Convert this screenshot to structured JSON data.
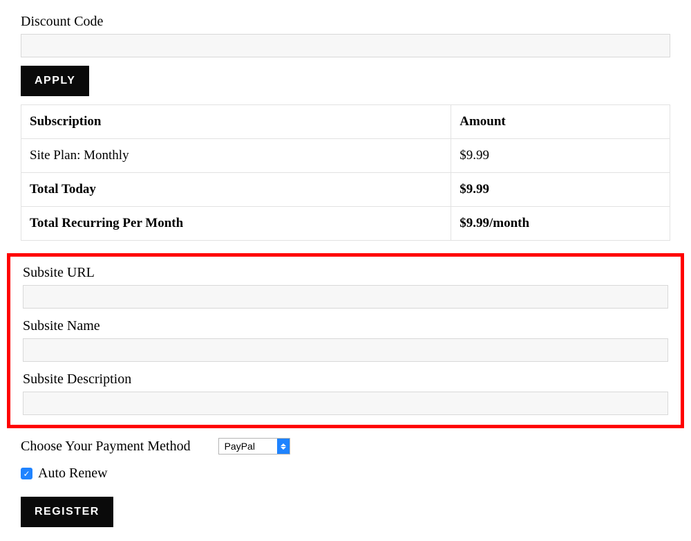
{
  "discount": {
    "label": "Discount Code",
    "value": "",
    "apply_label": "APPLY"
  },
  "table": {
    "headers": {
      "col1": "Subscription",
      "col2": "Amount"
    },
    "row_plan": {
      "label": "Site Plan: Monthly",
      "amount": "$9.99"
    },
    "row_total_today": {
      "label": "Total Today",
      "amount": "$9.99"
    },
    "row_recurring": {
      "label": "Total Recurring Per Month",
      "amount": "$9.99/month"
    }
  },
  "subsite": {
    "url_label": "Subsite URL",
    "url_value": "",
    "name_label": "Subsite Name",
    "name_value": "",
    "desc_label": "Subsite Description",
    "desc_value": ""
  },
  "payment": {
    "label": "Choose Your Payment Method",
    "selected": "PayPal"
  },
  "auto_renew": {
    "label": "Auto Renew",
    "checked": true
  },
  "register_label": "REGISTER"
}
